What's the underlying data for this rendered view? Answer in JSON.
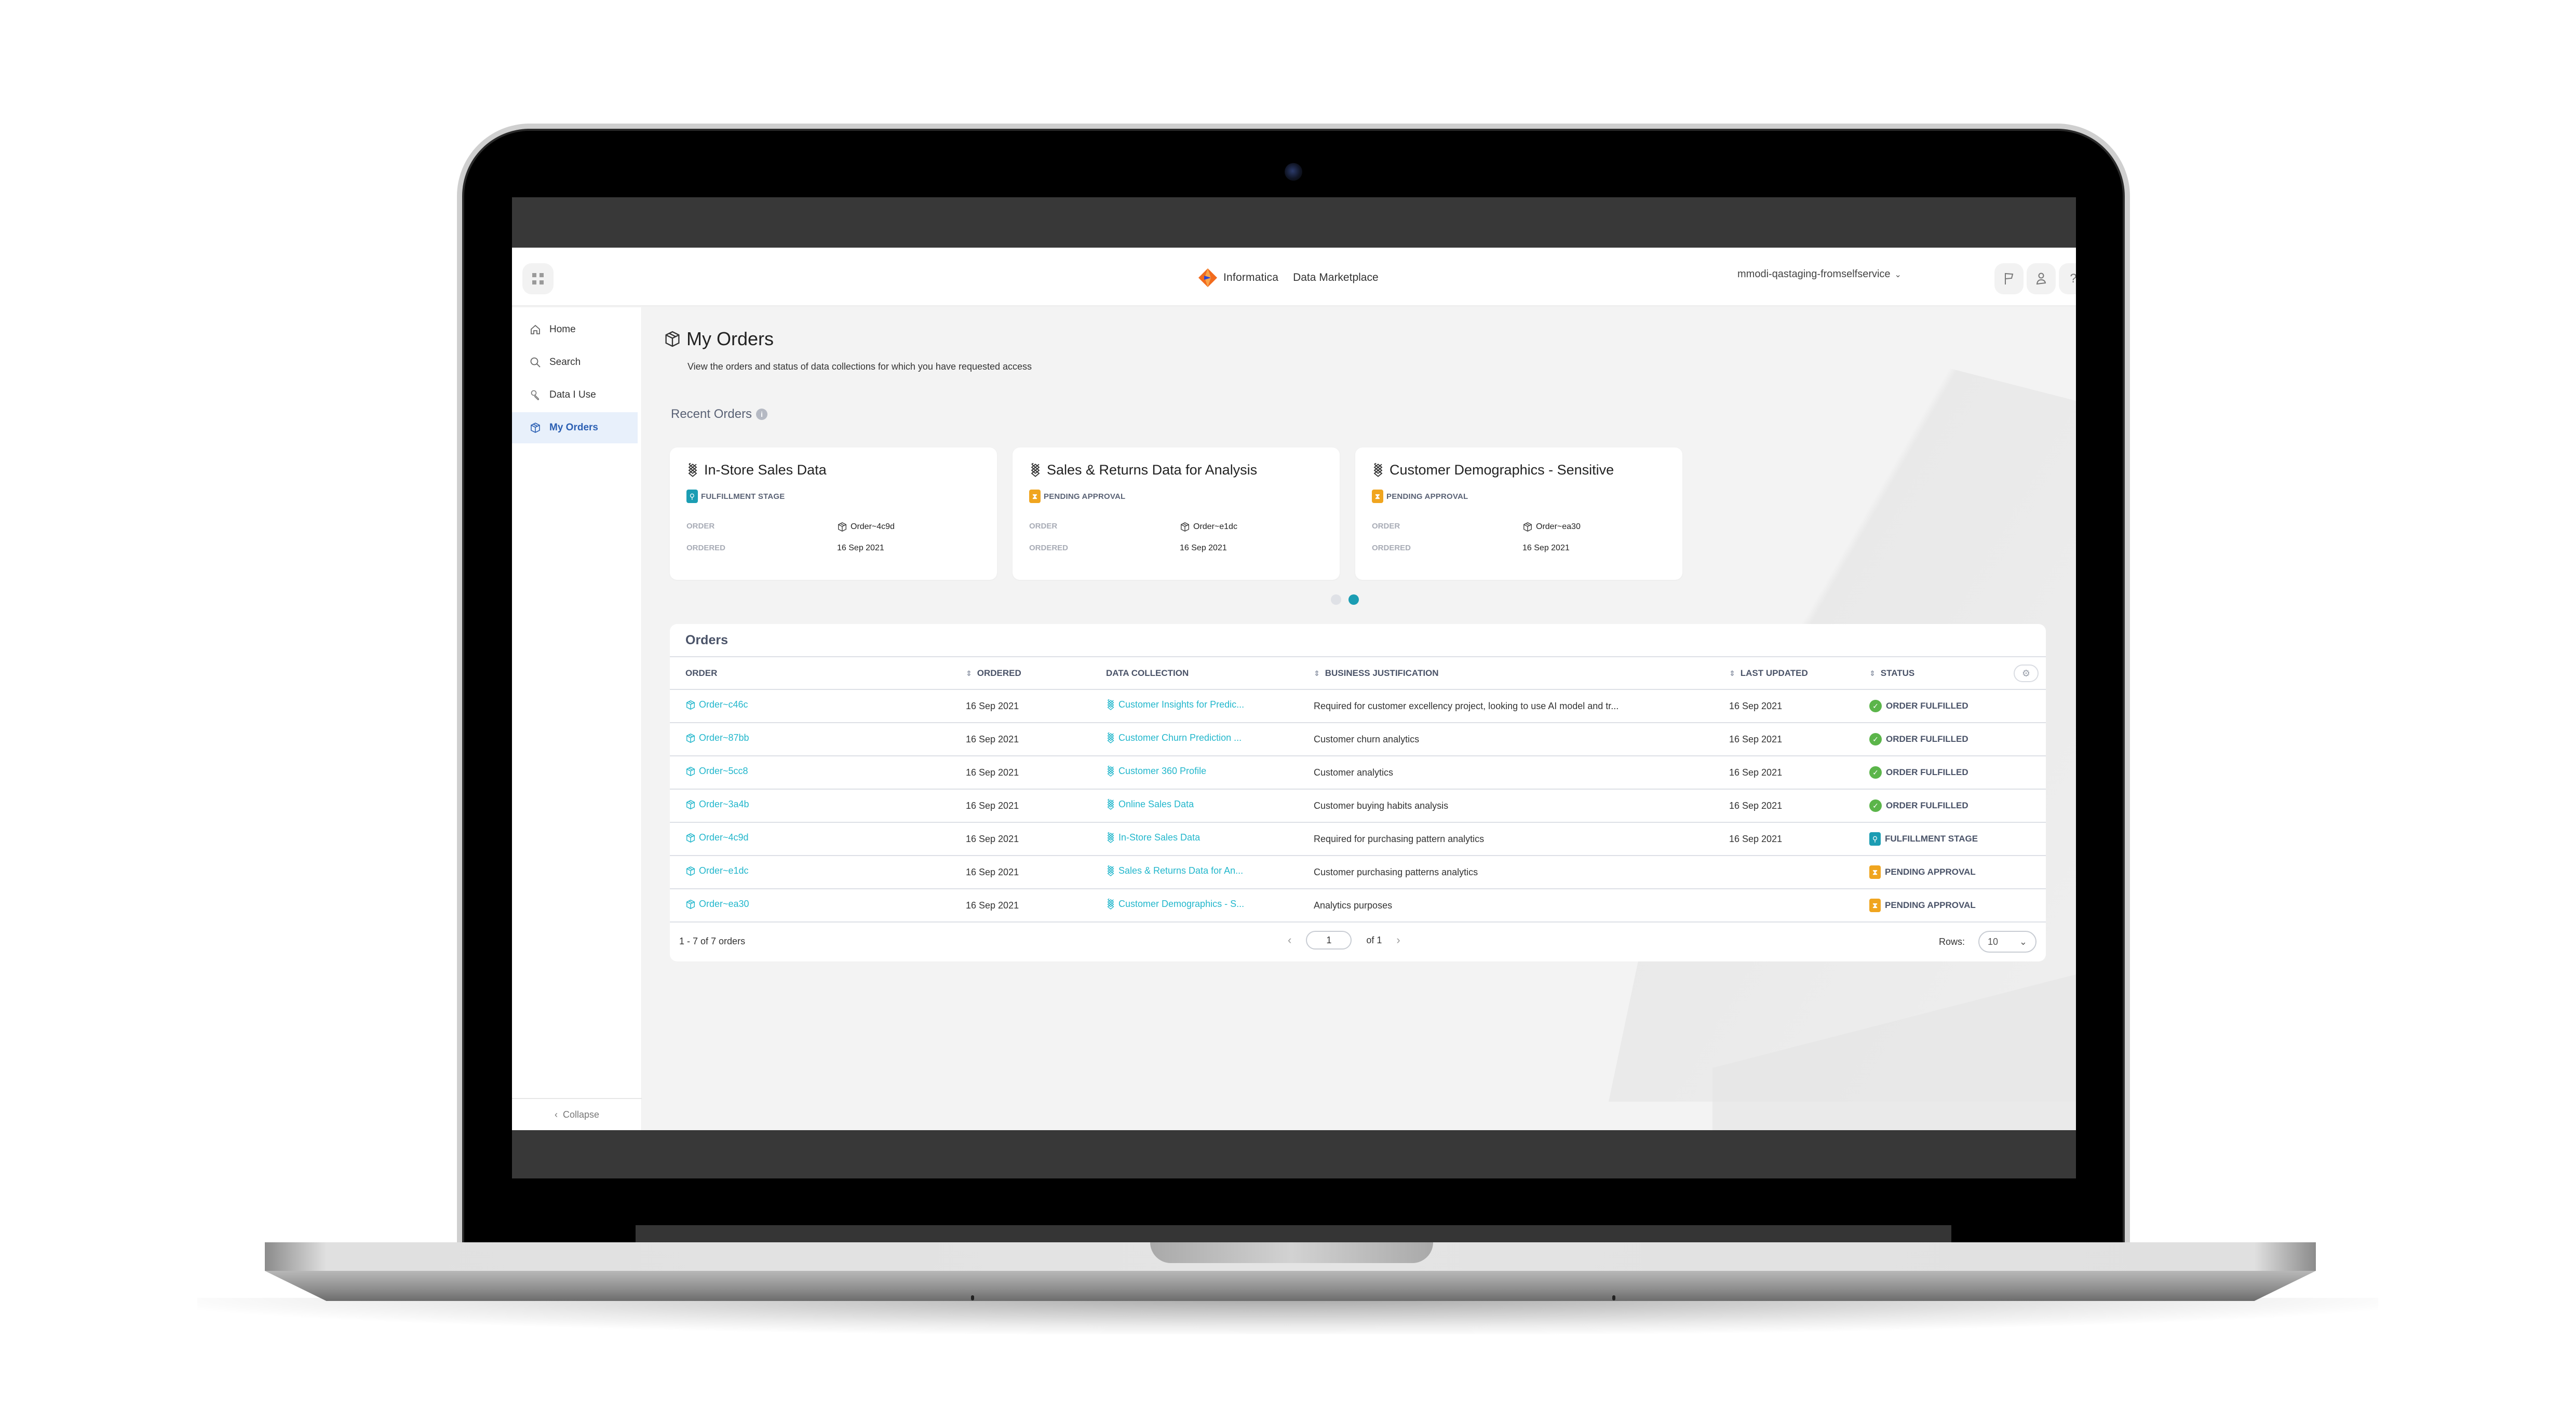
{
  "header": {
    "brand_name": "Informatica",
    "product_name": "Data Marketplace",
    "org_name": "mmodi-qastaging-fromselfservice",
    "icons": [
      "flag-icon",
      "user-icon",
      "help-icon"
    ],
    "help_glyph": "?"
  },
  "sidebar": {
    "items": [
      {
        "label": "Home",
        "icon": "home-icon",
        "active": false
      },
      {
        "label": "Search",
        "icon": "search-icon",
        "active": false
      },
      {
        "label": "Data I Use",
        "icon": "data-use-icon",
        "active": false
      },
      {
        "label": "My Orders",
        "icon": "package-icon",
        "active": true
      }
    ],
    "collapse_label": "Collapse"
  },
  "page": {
    "title": "My Orders",
    "description": "View the orders and status of data collections for which you have requested access",
    "recent_orders_label": "Recent Orders",
    "info_glyph": "i"
  },
  "recent_cards": [
    {
      "title": "In-Store Sales Data",
      "status": "FULFILLMENT STAGE",
      "status_type": "fulfillment",
      "order_label": "ORDER",
      "order": "Order~4c9d",
      "ordered_label": "ORDERED",
      "ordered": "16 Sep 2021"
    },
    {
      "title": "Sales & Returns Data for Analysis",
      "status": "PENDING APPROVAL",
      "status_type": "pending",
      "order_label": "ORDER",
      "order": "Order~e1dc",
      "ordered_label": "ORDERED",
      "ordered": "16 Sep 2021"
    },
    {
      "title": "Customer Demographics - Sensitive",
      "status": "PENDING APPROVAL",
      "status_type": "pending",
      "order_label": "ORDER",
      "order": "Order~ea30",
      "ordered_label": "ORDERED",
      "ordered": "16 Sep 2021"
    }
  ],
  "carousel": {
    "pages": 2,
    "active_page": 2
  },
  "orders_table": {
    "title": "Orders",
    "columns": [
      "ORDER",
      "ORDERED",
      "DATA COLLECTION",
      "BUSINESS JUSTIFICATION",
      "LAST UPDATED",
      "STATUS"
    ],
    "sortable": [
      false,
      true,
      false,
      true,
      true,
      true
    ],
    "rows": [
      {
        "order": "Order~c46c",
        "ordered": "16 Sep 2021",
        "collection": "Customer Insights for Predic...",
        "justification": "Required for customer excellency project, looking to use AI model and tr...",
        "last_updated": "16 Sep 2021",
        "status": "ORDER FULFILLED",
        "status_type": "fulfilled"
      },
      {
        "order": "Order~87bb",
        "ordered": "16 Sep 2021",
        "collection": "Customer Churn Prediction ...",
        "justification": "Customer churn analytics",
        "last_updated": "16 Sep 2021",
        "status": "ORDER FULFILLED",
        "status_type": "fulfilled"
      },
      {
        "order": "Order~5cc8",
        "ordered": "16 Sep 2021",
        "collection": "Customer 360 Profile",
        "justification": "Customer analytics",
        "last_updated": "16 Sep 2021",
        "status": "ORDER FULFILLED",
        "status_type": "fulfilled"
      },
      {
        "order": "Order~3a4b",
        "ordered": "16 Sep 2021",
        "collection": "Online Sales Data",
        "justification": "Customer buying habits analysis",
        "last_updated": "16 Sep 2021",
        "status": "ORDER FULFILLED",
        "status_type": "fulfilled"
      },
      {
        "order": "Order~4c9d",
        "ordered": "16 Sep 2021",
        "collection": "In-Store Sales Data",
        "justification": "Required for purchasing pattern analytics",
        "last_updated": "16 Sep 2021",
        "status": "FULFILLMENT STAGE",
        "status_type": "fulfillment"
      },
      {
        "order": "Order~e1dc",
        "ordered": "16 Sep 2021",
        "collection": "Sales & Returns Data for An...",
        "justification": "Customer purchasing patterns analytics",
        "last_updated": "",
        "status": "PENDING APPROVAL",
        "status_type": "pending"
      },
      {
        "order": "Order~ea30",
        "ordered": "16 Sep 2021",
        "collection": "Customer Demographics - S...",
        "justification": "Analytics purposes",
        "last_updated": "",
        "status": "PENDING APPROVAL",
        "status_type": "pending"
      }
    ],
    "footer": {
      "range_text": "1 - 7 of 7 orders",
      "current_page": "1",
      "of_text": "of 1",
      "rows_label": "Rows:",
      "rows_value": "10"
    }
  },
  "colors": {
    "accent_teal": "#1b9db3",
    "link_cyan": "#23b7cc",
    "pending_amber": "#f0a51f",
    "fulfilled_green": "#5bb54a",
    "active_nav_blue": "#2b5fb3"
  }
}
